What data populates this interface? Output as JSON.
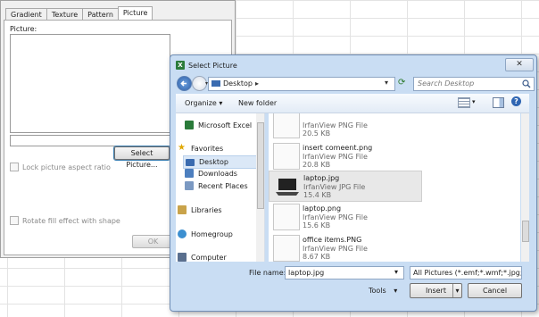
{
  "fill_effects": {
    "tabs": [
      "Gradient",
      "Texture",
      "Pattern",
      "Picture"
    ],
    "picture_label": "Picture:",
    "select_picture_button": "Select Picture...",
    "lock_aspect_label": "Lock picture aspect ratio",
    "rotate_label": "Rotate fill effect with shape",
    "ok_label": "OK"
  },
  "dialog": {
    "title": "Select Picture",
    "close_glyph": "✕",
    "address": "Desktop",
    "search_placeholder": "Search Desktop",
    "organize_label": "Organize ▾",
    "new_folder_label": "New folder",
    "help_glyph": "?",
    "nav": [
      {
        "label": "Microsoft Excel",
        "icon": "excel-icon"
      },
      {
        "label": "Favorites",
        "icon": "star-icon"
      },
      {
        "label": "Desktop",
        "icon": "desktop-icon"
      },
      {
        "label": "Downloads",
        "icon": "downloads-icon"
      },
      {
        "label": "Recent Places",
        "icon": "recent-places-icon"
      },
      {
        "label": "Libraries",
        "icon": "libraries-icon"
      },
      {
        "label": "Homegroup",
        "icon": "homegroup-icon"
      },
      {
        "label": "Computer",
        "icon": "computer-icon"
      }
    ],
    "files": [
      {
        "name": "",
        "type": "IrfanView PNG File",
        "size": "20.5 KB"
      },
      {
        "name": "insert comeent.png",
        "type": "IrfanView PNG File",
        "size": "20.8 KB"
      },
      {
        "name": "laptop.jpg",
        "type": "IrfanView JPG File",
        "size": "15.4 KB"
      },
      {
        "name": "laptop.png",
        "type": "IrfanView PNG File",
        "size": "15.6 KB"
      },
      {
        "name": "office items.PNG",
        "type": "IrfanView PNG File",
        "size": "8.67 KB"
      }
    ],
    "file_name_label": "File name:",
    "file_name_value": "laptop.jpg",
    "file_type_value": "All Pictures (*.emf;*.wmf;*.jpg;*",
    "tools_label": "Tools",
    "insert_label": "Insert",
    "cancel_label": "Cancel"
  }
}
